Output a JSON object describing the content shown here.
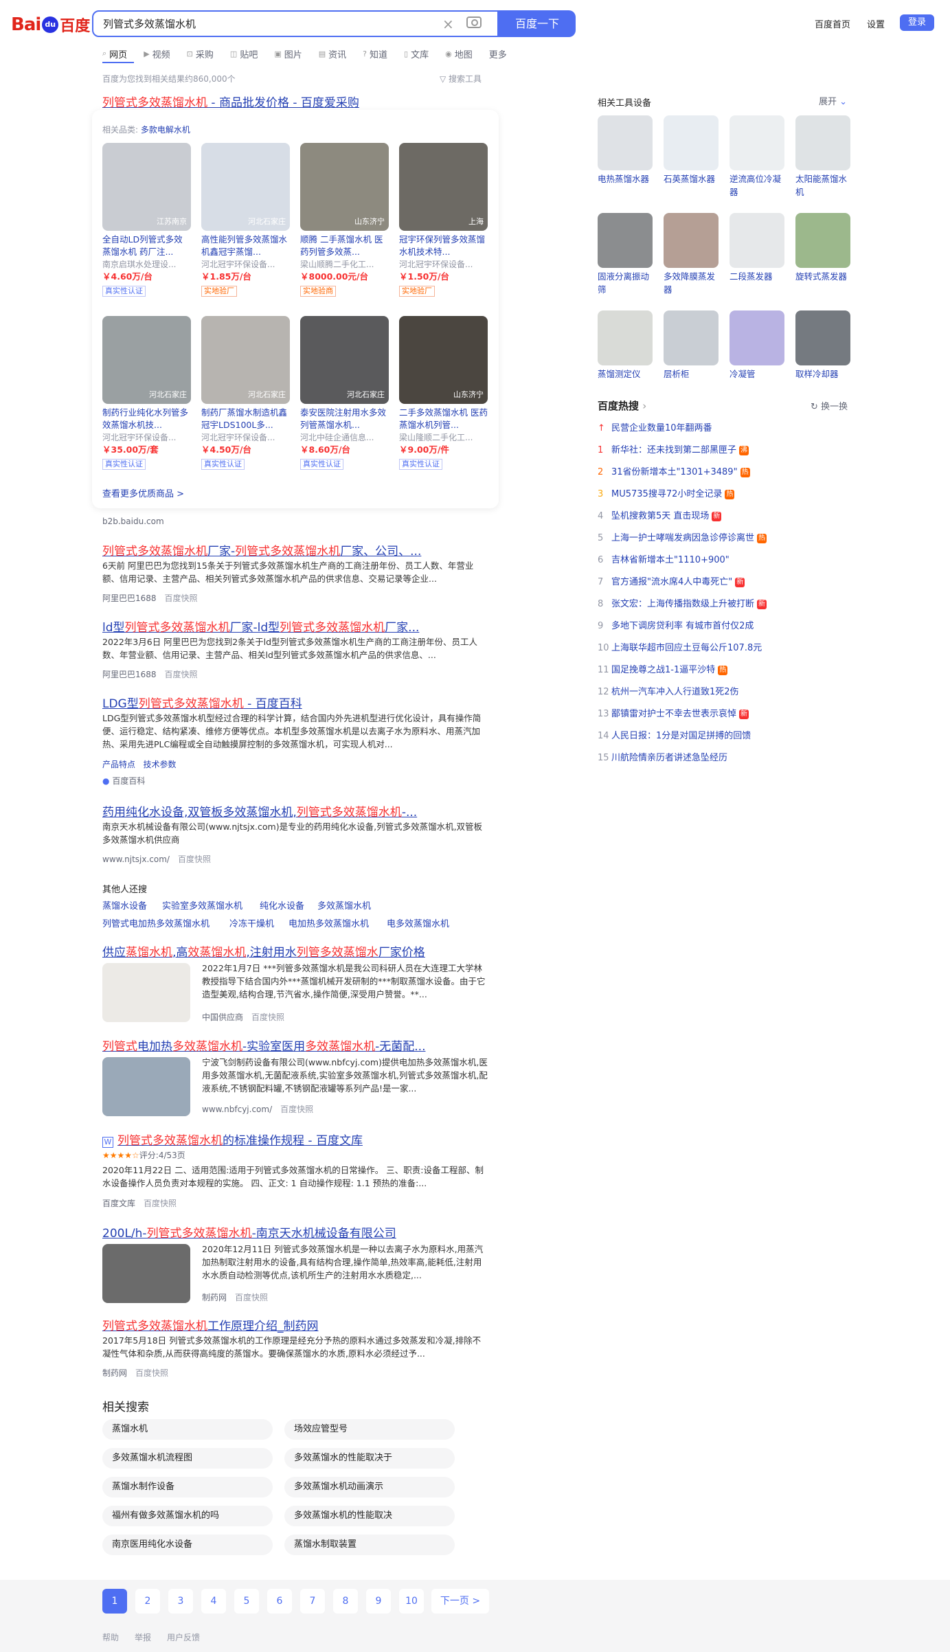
{
  "header": {
    "logo_bai": "Bai",
    "logo_du": "百度",
    "search_value": "列管式多效蒸馏水机",
    "search_button": "百度一下",
    "links": [
      "百度首页",
      "设置"
    ],
    "login": "登录"
  },
  "tabs": [
    "网页",
    "视频",
    "采购",
    "贴吧",
    "图片",
    "资讯",
    "知道",
    "文库",
    "地图",
    "更多"
  ],
  "count": "百度为您找到相关结果约860,000个",
  "search_tools": "搜索工具",
  "r1": {
    "title": "列管式多效蒸馏水机 - 商品批发价格 - 百度爱采购",
    "related_label": "相关品类:",
    "related_value": "多款电解水机",
    "more": "查看更多优质商品 >",
    "source": "b2b.baidu.com"
  },
  "products": [
    {
      "t": "全自动LD列管式多效蒸馏水机 药厂注...",
      "c": "南京启琪水处理设...",
      "p": "￥4.60万/台",
      "g": "真实性认证",
      "l": "江苏南京",
      "col": "#c9ccd2"
    },
    {
      "t": "高性能列管多效蒸馏水机鑫冠宇蒸馏...",
      "c": "河北冠宇环保设备...",
      "p": "￥1.85万/台",
      "g": "实地验厂",
      "l": "河北石家庄",
      "col": "#d7dde6"
    },
    {
      "t": "顺腾 二手蒸馏水机 医药列管多效蒸...",
      "c": "梁山顺腾二手化工...",
      "p": "￥8000.00元/台",
      "g": "实地验商",
      "l": "山东济宁",
      "col": "#8d8a7f"
    },
    {
      "t": "冠宇环保列管多效蒸馏水机技术特...",
      "c": "河北冠宇环保设备...",
      "p": "￥1.50万/台",
      "g": "实地验厂",
      "l": "上海",
      "col": "#6d6a64"
    },
    {
      "t": "制药行业纯化水列管多效蒸馏水机技...",
      "c": "河北冠宇环保设备...",
      "p": "￥35.00万/套",
      "g": "真实性认证",
      "l": "河北石家庄",
      "col": "#9aa0a2"
    },
    {
      "t": "制药厂蒸馏水制造机鑫冠宇LDS100L多...",
      "c": "河北冠宇环保设备...",
      "p": "￥4.50万/台",
      "g": "真实性认证",
      "l": "河北石家庄",
      "col": "#b7b4b0"
    },
    {
      "t": "泰安医院注射用水多效列管蒸馏水机...",
      "c": "河北中硅企通信息...",
      "p": "￥8.60万/台",
      "g": "真实性认证",
      "l": "河北石家庄",
      "col": "#5a5a5c"
    },
    {
      "t": "二手多效蒸馏水机 医药蒸馏水机列管...",
      "c": "梁山隆顺二手化工...",
      "p": "￥9.00万/件",
      "g": "真实性认证",
      "l": "山东济宁",
      "col": "#4b4640"
    }
  ],
  "results": [
    {
      "title": "列管式多效蒸馏水机厂家-列管式多效蒸馏水机厂家、公司、...",
      "abs": "6天前 阿里巴巴为您找到15条关于列管式多效蒸馏水机生产商的工商注册年份、员工人数、年营业额、信用记录、主营产品、相关列管式多效蒸馏水机产品的供求信息、交易记录等企业...",
      "src": "阿里巴巴1688",
      "snap": "百度快照"
    },
    {
      "title": "ld型列管式多效蒸馏水机厂家-ld型列管式多效蒸馏水机厂家...",
      "abs": "2022年3月6日 阿里巴巴为您找到2条关于ld型列管式多效蒸馏水机生产商的工商注册年份、员工人数、年营业额、信用记录、主营产品、相关ld型列管式多效蒸馏水机产品的供求信息、...",
      "src": "阿里巴巴1688",
      "snap": "百度快照"
    },
    {
      "title": "LDG型列管式多效蒸馏水机 - 百度百科",
      "abs": "LDG型列管式多效蒸馏水机型经过合理的科学计算，结合国内外先进机型进行优化设计，具有操作简便、运行稳定、结构紧凑、维修方便等优点。本机型多效蒸馏水机是以去离子水为原料水、用蒸汽加热、采用先进PLC编程或全自动触摸屏控制的多效蒸馏水机，可实现人机对...",
      "links": [
        "产品特点",
        "技术参数"
      ],
      "src": "百度百科",
      "snap": ""
    },
    {
      "title": "药用纯化水设备,双管板多效蒸馏水机,列管式多效蒸馏水机-...",
      "abs": "南京天水机械设备有限公司(www.njtsjx.com)是专业的药用纯化水设备,列管式多效蒸馏水机,双管板多效蒸馏水机供应商",
      "src": "www.njtsjx.com/",
      "snap": "百度快照"
    }
  ],
  "others": {
    "title": "其他人还搜",
    "items": [
      "蒸馏水设备",
      "实验室多效蒸馏水机",
      "纯化水设备",
      "多效蒸馏水机",
      "列管式电加热多效蒸馏水机",
      "冷冻干燥机",
      "电加热多效蒸馏水机",
      "电多效蒸馏水机"
    ]
  },
  "results2": [
    {
      "title": "供应蒸馏水机,高效蒸馏水机,注射用水列管多效蒸馏水厂家价格",
      "abs": "2022年1月7日 ***列管多效蒸馏水机是我公司科研人员在大连理工大学林教授指导下结合国内外***蒸馏机械开发研制的***制取蒸馏水设备。由于它造型美观,结构合理,节汽省水,操作简便,深受用户赞誉。**...",
      "src": "中国供应商",
      "snap": "百度快照",
      "col": "#eceae6"
    },
    {
      "title": "列管式电加热多效蒸馏水机-实验室医用多效蒸馏水机-无菌配...",
      "abs": "宁波飞剑制药设备有限公司(www.nbfcyj.com)提供电加热多效蒸馏水机,医用多效蒸馏水机,无菌配液系统,实验室多效蒸馏水机,列管式多效蒸馏水机,配液系统,不锈钢配料罐,不锈钢配液罐等系列产品!是一家...",
      "src": "www.nbfcyj.com/",
      "snap": "百度快照",
      "col": "#9aa9b8"
    },
    {
      "title": "列管式多效蒸馏水机的标准操作规程 - 百度文库",
      "rating": "评分:4/53页",
      "abs": "2020年11月22日 二、适用范围:适用于列管式多效蒸馏水机的日常操作。 三、职责:设备工程部、制水设备操作人员负责对本规程的实施。 四、正文: 1 自动操作规程: 1.1 预热的准备:...",
      "src": "百度文库",
      "snap": "百度快照"
    },
    {
      "title": "200L/h-列管式多效蒸馏水机-南京天水机械设备有限公司",
      "abs": "2020年12月11日 列管式多效蒸馏水机是一种以去离子水为原料水,用蒸汽加热制取注射用水的设备,具有结构合理,操作简单,热效率高,能耗低,注射用水水质自动检测等优点,该机所生产的注射用水水质稳定,...",
      "src": "制药网",
      "snap": "百度快照",
      "col": "#6b6b6b"
    },
    {
      "title": "列管式多效蒸馏水机工作原理介绍_制药网",
      "abs": "2017年5月18日 列管式多效蒸馏水机的工作原理是经充分予热的原料水通过多效蒸发和冷凝,排除不凝性气体和杂质,从而获得高纯度的蒸馏水。要确保蒸馏水的水质,原料水必须经过予...",
      "src": "制药网",
      "snap": "百度快照"
    }
  ],
  "related": {
    "title": "相关搜索",
    "items": [
      "蒸馏水机",
      "场效应管型号",
      "多效蒸馏水机流程图",
      "多效蒸馏水的性能取决于",
      "蒸馏水制作设备",
      "多效蒸馏水机动画演示",
      "福州有做多效蒸馏水机的吗",
      "多效蒸馏水机的性能取决",
      "南京医用纯化水设备",
      "蒸馏水制取装置"
    ]
  },
  "sidebar": {
    "tools_title": "相关工具设备",
    "expand": "展开",
    "tools": [
      {
        "n": "电热蒸馏水器",
        "c": "#dfe2e6"
      },
      {
        "n": "石英蒸馏水器",
        "c": "#e8edf2"
      },
      {
        "n": "逆流高位冷凝器",
        "c": "#eceff1"
      },
      {
        "n": "太阳能蒸馏水机",
        "c": "#dfe3e5"
      },
      {
        "n": "固液分离振动筛",
        "c": "#8b8d8f"
      },
      {
        "n": "多效降膜蒸发器",
        "c": "#b59f95"
      },
      {
        "n": "二段蒸发器",
        "c": "#e6e8ea"
      },
      {
        "n": "旋转式蒸发器",
        "c": "#9cb88c"
      },
      {
        "n": "蒸馏测定仪",
        "c": "#d9dbd7"
      },
      {
        "n": "层析柜",
        "c": "#c9ced4"
      },
      {
        "n": "冷凝管",
        "c": "#b9b3e3"
      },
      {
        "n": "取样冷却器",
        "c": "#757a80"
      }
    ],
    "hot_title": "百度热搜",
    "refresh": "换一换",
    "hot": [
      {
        "n": "↑",
        "t": "民营企业数量10年翻两番",
        "b": ""
      },
      {
        "n": "1",
        "t": "新华社：还未找到第二部黑匣子",
        "b": "沸"
      },
      {
        "n": "2",
        "t": "31省份新增本土\"1301+3489\"",
        "b": "热"
      },
      {
        "n": "3",
        "t": "MU5735搜寻72小时全记录",
        "b": "热"
      },
      {
        "n": "4",
        "t": "坠机搜救第5天 直击现场",
        "b": "新"
      },
      {
        "n": "5",
        "t": "上海一护士哮喘发病因急诊停诊离世",
        "b": "热"
      },
      {
        "n": "6",
        "t": "吉林省新增本土\"1110+900\"",
        "b": ""
      },
      {
        "n": "7",
        "t": "官方通报\"流水席4人中毒死亡\"",
        "b": "新"
      },
      {
        "n": "8",
        "t": "张文宏：上海传播指数级上升被打断",
        "b": "新"
      },
      {
        "n": "9",
        "t": "多地下调房贷利率 有城市首付仅2成",
        "b": ""
      },
      {
        "n": "10",
        "t": "上海联华超市回应土豆每公斤107.8元",
        "b": ""
      },
      {
        "n": "11",
        "t": "国足挽尊之战1-1逼平沙特",
        "b": "热"
      },
      {
        "n": "12",
        "t": "杭州一汽车冲入人行道致1死2伤",
        "b": ""
      },
      {
        "n": "13",
        "t": "鄙镇雷对护士不幸去世表示哀悼",
        "b": "新"
      },
      {
        "n": "14",
        "t": "人民日报：1分是对国足拼搏的回馈",
        "b": ""
      },
      {
        "n": "15",
        "t": "川航险情亲历者讲述急坠经历",
        "b": ""
      }
    ]
  },
  "pager": {
    "pages": [
      "1",
      "2",
      "3",
      "4",
      "5",
      "6",
      "7",
      "8",
      "9",
      "10"
    ],
    "next": "下一页 >"
  },
  "footer": [
    "帮助",
    "举报",
    "用户反馈"
  ]
}
